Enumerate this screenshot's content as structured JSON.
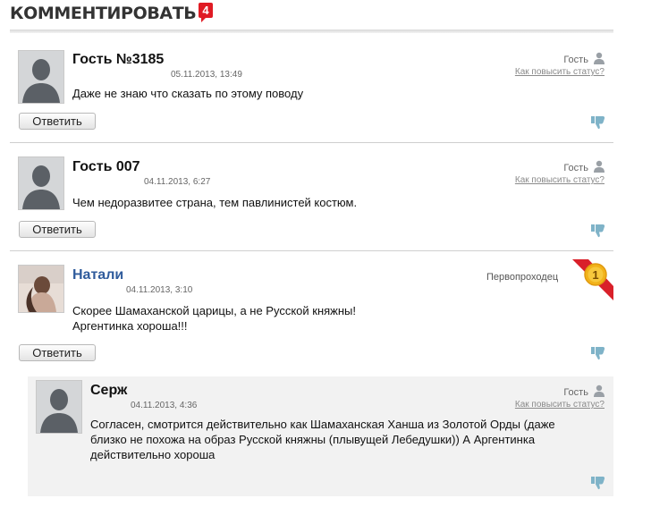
{
  "header": {
    "title": "КОММЕНТИРОВАТЬ",
    "count": "4"
  },
  "comments": [
    {
      "author": "Гость №3185",
      "date": "05.11.2013, 13:49",
      "text": "Даже не знаю что сказать по этому поводу",
      "role": "Гость",
      "status_link": "Как повысить статус?",
      "reply_label": "Ответить"
    },
    {
      "author": "Гость 007",
      "date": "04.11.2013, 6:27",
      "text": "Чем недоразвитее страна, тем павлинистей костюм.",
      "role": "Гость",
      "status_link": "Как повысить статус?",
      "reply_label": "Ответить"
    },
    {
      "author": "Натали",
      "date": "04.11.2013, 3:10",
      "text_line1": "Скорее Шамаханской царицы, а не Русской княжны!",
      "text_line2": "Аргентинка хороша!!!",
      "role": "Первопроходец",
      "medal": "1",
      "reply_label": "Ответить"
    },
    {
      "author": "Серж",
      "date": "04.11.2013, 4:36",
      "text_line1": "Согласен, смотрится действительно как Шамаханская Ханша из Золотой Орды (даже",
      "text_line2": "близко не похожа на образ Русской княжны (плывущей Лебедушки)) А Аргентинка",
      "text_line3": "действительно хороша",
      "role": "Гость",
      "status_link": "Как повысить статус?"
    }
  ],
  "colors": {
    "accent_red": "#e01b24",
    "name_blue": "#2f5b9c",
    "reply_bg": "#f2f2f2"
  }
}
